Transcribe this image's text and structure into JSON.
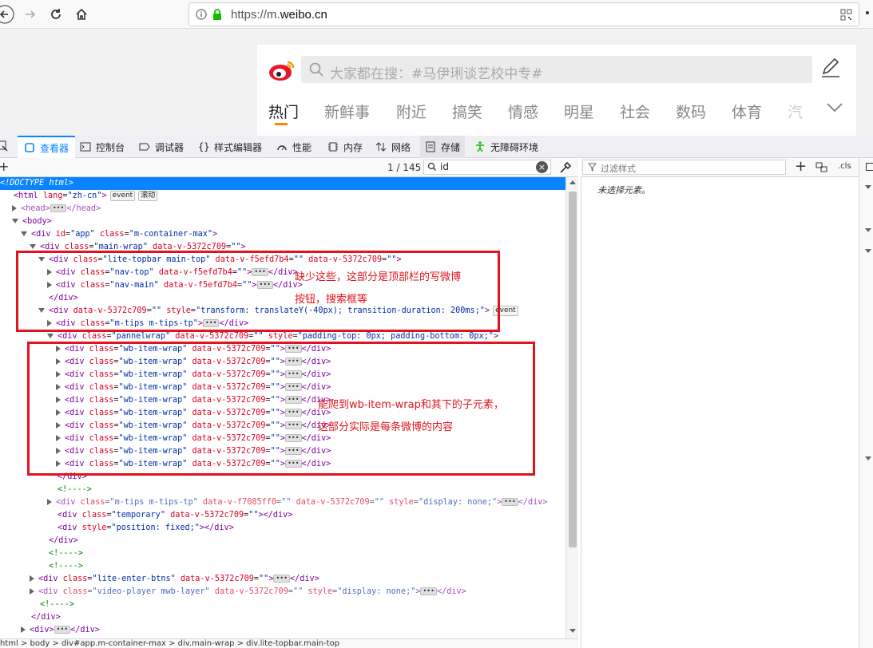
{
  "browser": {
    "url_prefix": "https://m.",
    "url_domain": "weibo.cn"
  },
  "weibo": {
    "search_placeholder": "大家都在搜：#马伊琍谈艺校中专#",
    "channels": [
      "热门",
      "新鲜事",
      "附近",
      "搞笑",
      "情感",
      "明星",
      "社会",
      "数码",
      "体育",
      "汽"
    ]
  },
  "devtools": {
    "tabs": [
      "查看器",
      "控制台",
      "调试器",
      "样式编辑器",
      "性能",
      "内存",
      "网络",
      "存储",
      "无障碍环境"
    ],
    "search_count": "1 / 145",
    "search_value": "id",
    "filter_placeholder": "过滤样式",
    "cls_label": ".cls",
    "no_selection": "未选择元素。",
    "event_badge": "event",
    "scroll_badge": "滚动",
    "breadcrumb": "html > body > div#app.m-container-max > div.main-wrap > div.lite-topbar.main-top"
  },
  "markup_lines": [
    {
      "i": 0,
      "t": "none",
      "sel": true,
      "h": [
        [
          "tx",
          "<!DOCTYPE html>"
        ]
      ]
    },
    {
      "i": 0,
      "t": "none",
      "h": [
        [
          "tg",
          "<html "
        ],
        [
          "at",
          "lang"
        ],
        [
          "tx",
          "="
        ],
        [
          "av",
          "\"zh-cn\""
        ],
        [
          "tg",
          ">"
        ]
      ],
      "b": [
        "event",
        "滚动"
      ]
    },
    {
      "i": 1,
      "t": "closed",
      "dim": true,
      "h": [
        [
          "tg",
          "<head>"
        ]
      ],
      "ell": true,
      "h2": [
        [
          "tg",
          "</head>"
        ]
      ]
    },
    {
      "i": 1,
      "t": "open",
      "h": [
        [
          "tg",
          "<body>"
        ]
      ]
    },
    {
      "i": 2,
      "t": "open",
      "h": [
        [
          "tg",
          "<div "
        ],
        [
          "at",
          "id"
        ],
        [
          "tx",
          "="
        ],
        [
          "av",
          "\"app\""
        ],
        [
          "at",
          " class"
        ],
        [
          "tx",
          "="
        ],
        [
          "av",
          "\"m-container-max\""
        ],
        [
          "tg",
          ">"
        ]
      ]
    },
    {
      "i": 3,
      "t": "open",
      "h": [
        [
          "tg",
          "<div "
        ],
        [
          "at",
          "class"
        ],
        [
          "tx",
          "="
        ],
        [
          "av",
          "\"main-wrap\""
        ],
        [
          "at",
          " data-v-5372c709"
        ],
        [
          "tx",
          "="
        ],
        [
          "av",
          "\"\""
        ],
        [
          "tg",
          ">"
        ]
      ]
    },
    {
      "i": 4,
      "t": "open",
      "h": [
        [
          "tg",
          "<div "
        ],
        [
          "at",
          "class"
        ],
        [
          "tx",
          "="
        ],
        [
          "av",
          "\"lite-topbar main-top\""
        ],
        [
          "at",
          " data-v-f5efd7b4"
        ],
        [
          "tx",
          "="
        ],
        [
          "av",
          "\"\""
        ],
        [
          "at",
          " data-v-5372c709"
        ],
        [
          "tx",
          "="
        ],
        [
          "av",
          "\"\""
        ],
        [
          "tg",
          ">"
        ]
      ]
    },
    {
      "i": 5,
      "t": "closed",
      "h": [
        [
          "tg",
          "<div "
        ],
        [
          "at",
          "class"
        ],
        [
          "tx",
          "="
        ],
        [
          "av",
          "\"nav-top\""
        ],
        [
          "at",
          " data-v-f5efd7b4"
        ],
        [
          "tx",
          "="
        ],
        [
          "av",
          "\"\""
        ],
        [
          "tg",
          ">"
        ]
      ],
      "ell": true,
      "h2": [
        [
          "tg",
          "</div>"
        ]
      ]
    },
    {
      "i": 5,
      "t": "closed",
      "h": [
        [
          "tg",
          "<div "
        ],
        [
          "at",
          "class"
        ],
        [
          "tx",
          "="
        ],
        [
          "av",
          "\"nav-main\""
        ],
        [
          "at",
          " data-v-f5efd7b4"
        ],
        [
          "tx",
          "="
        ],
        [
          "av",
          "\"\""
        ],
        [
          "tg",
          ">"
        ]
      ],
      "ell": true,
      "h2": [
        [
          "tg",
          "</div>"
        ]
      ]
    },
    {
      "i": 4,
      "t": "none",
      "h": [
        [
          "tg",
          "</div>"
        ]
      ]
    },
    {
      "i": 4,
      "t": "open",
      "h": [
        [
          "tg",
          "<div "
        ],
        [
          "at",
          "data-v-5372c709"
        ],
        [
          "tx",
          "="
        ],
        [
          "av",
          "\"\""
        ],
        [
          "at",
          " style"
        ],
        [
          "tx",
          "="
        ],
        [
          "av",
          "\"transform: translateY(-40px); transition-duration: 200ms;\""
        ],
        [
          "tg",
          ">"
        ]
      ],
      "b": [
        "event"
      ]
    },
    {
      "i": 5,
      "t": "closed",
      "h": [
        [
          "tg",
          "<div "
        ],
        [
          "at",
          "class"
        ],
        [
          "tx",
          "="
        ],
        [
          "av",
          "\"m-tips m-tips-tp\""
        ],
        [
          "tg",
          ">"
        ]
      ],
      "ell": true,
      "h2": [
        [
          "tg",
          "</div>"
        ]
      ]
    },
    {
      "i": 5,
      "t": "open",
      "h": [
        [
          "tg",
          "<div "
        ],
        [
          "at",
          "class"
        ],
        [
          "tx",
          "="
        ],
        [
          "av",
          "\"pannelwrap\""
        ],
        [
          "at",
          " data-v-5372c709"
        ],
        [
          "tx",
          "="
        ],
        [
          "av",
          "\"\""
        ],
        [
          "at",
          " style"
        ],
        [
          "tx",
          "="
        ],
        [
          "av",
          "\"padding-top: 0px; padding-bottom: 0px;\""
        ],
        [
          "tg",
          ">"
        ]
      ]
    },
    {
      "i": 6,
      "t": "closed",
      "h": [
        [
          "tg",
          "<div "
        ],
        [
          "at",
          "class"
        ],
        [
          "tx",
          "="
        ],
        [
          "av",
          "\"wb-item-wrap\""
        ],
        [
          "at",
          " data-v-5372c709"
        ],
        [
          "tx",
          "="
        ],
        [
          "av",
          "\"\""
        ],
        [
          "tg",
          ">"
        ]
      ],
      "ell": true,
      "h2": [
        [
          "tg",
          "</div>"
        ]
      ]
    },
    {
      "i": 6,
      "t": "closed",
      "h": [
        [
          "tg",
          "<div "
        ],
        [
          "at",
          "class"
        ],
        [
          "tx",
          "="
        ],
        [
          "av",
          "\"wb-item-wrap\""
        ],
        [
          "at",
          " data-v-5372c709"
        ],
        [
          "tx",
          "="
        ],
        [
          "av",
          "\"\""
        ],
        [
          "tg",
          ">"
        ]
      ],
      "ell": true,
      "h2": [
        [
          "tg",
          "</div>"
        ]
      ]
    },
    {
      "i": 6,
      "t": "closed",
      "h": [
        [
          "tg",
          "<div "
        ],
        [
          "at",
          "class"
        ],
        [
          "tx",
          "="
        ],
        [
          "av",
          "\"wb-item-wrap\""
        ],
        [
          "at",
          " data-v-5372c709"
        ],
        [
          "tx",
          "="
        ],
        [
          "av",
          "\"\""
        ],
        [
          "tg",
          ">"
        ]
      ],
      "ell": true,
      "h2": [
        [
          "tg",
          "</div>"
        ]
      ]
    },
    {
      "i": 6,
      "t": "closed",
      "h": [
        [
          "tg",
          "<div "
        ],
        [
          "at",
          "class"
        ],
        [
          "tx",
          "="
        ],
        [
          "av",
          "\"wb-item-wrap\""
        ],
        [
          "at",
          " data-v-5372c709"
        ],
        [
          "tx",
          "="
        ],
        [
          "av",
          "\"\""
        ],
        [
          "tg",
          ">"
        ]
      ],
      "ell": true,
      "h2": [
        [
          "tg",
          "</div>"
        ]
      ]
    },
    {
      "i": 6,
      "t": "closed",
      "h": [
        [
          "tg",
          "<div "
        ],
        [
          "at",
          "class"
        ],
        [
          "tx",
          "="
        ],
        [
          "av",
          "\"wb-item-wrap\""
        ],
        [
          "at",
          " data-v-5372c709"
        ],
        [
          "tx",
          "="
        ],
        [
          "av",
          "\"\""
        ],
        [
          "tg",
          ">"
        ]
      ],
      "ell": true,
      "h2": [
        [
          "tg",
          "</div>"
        ]
      ]
    },
    {
      "i": 6,
      "t": "closed",
      "h": [
        [
          "tg",
          "<div "
        ],
        [
          "at",
          "class"
        ],
        [
          "tx",
          "="
        ],
        [
          "av",
          "\"wb-item-wrap\""
        ],
        [
          "at",
          " data-v-5372c709"
        ],
        [
          "tx",
          "="
        ],
        [
          "av",
          "\"\""
        ],
        [
          "tg",
          ">"
        ]
      ],
      "ell": true,
      "h2": [
        [
          "tg",
          "</div>"
        ]
      ]
    },
    {
      "i": 6,
      "t": "closed",
      "h": [
        [
          "tg",
          "<div "
        ],
        [
          "at",
          "class"
        ],
        [
          "tx",
          "="
        ],
        [
          "av",
          "\"wb-item-wrap\""
        ],
        [
          "at",
          " data-v-5372c709"
        ],
        [
          "tx",
          "="
        ],
        [
          "av",
          "\"\""
        ],
        [
          "tg",
          ">"
        ]
      ],
      "ell": true,
      "h2": [
        [
          "tg",
          "</div>"
        ]
      ]
    },
    {
      "i": 6,
      "t": "closed",
      "h": [
        [
          "tg",
          "<div "
        ],
        [
          "at",
          "class"
        ],
        [
          "tx",
          "="
        ],
        [
          "av",
          "\"wb-item-wrap\""
        ],
        [
          "at",
          " data-v-5372c709"
        ],
        [
          "tx",
          "="
        ],
        [
          "av",
          "\"\""
        ],
        [
          "tg",
          ">"
        ]
      ],
      "ell": true,
      "h2": [
        [
          "tg",
          "</div>"
        ]
      ]
    },
    {
      "i": 6,
      "t": "closed",
      "h": [
        [
          "tg",
          "<div "
        ],
        [
          "at",
          "class"
        ],
        [
          "tx",
          "="
        ],
        [
          "av",
          "\"wb-item-wrap\""
        ],
        [
          "at",
          " data-v-5372c709"
        ],
        [
          "tx",
          "="
        ],
        [
          "av",
          "\"\""
        ],
        [
          "tg",
          ">"
        ]
      ],
      "ell": true,
      "h2": [
        [
          "tg",
          "</div>"
        ]
      ]
    },
    {
      "i": 6,
      "t": "closed",
      "h": [
        [
          "tg",
          "<div "
        ],
        [
          "at",
          "class"
        ],
        [
          "tx",
          "="
        ],
        [
          "av",
          "\"wb-item-wrap\""
        ],
        [
          "at",
          " data-v-5372c709"
        ],
        [
          "tx",
          "="
        ],
        [
          "av",
          "\"\""
        ],
        [
          "tg",
          ">"
        ]
      ],
      "ell": true,
      "h2": [
        [
          "tg",
          "</div>"
        ]
      ]
    },
    {
      "i": 5,
      "t": "none",
      "h": [
        [
          "tg",
          "</div>"
        ]
      ]
    },
    {
      "i": 5,
      "t": "none",
      "h": [
        [
          "cm",
          "<!---->"
        ]
      ]
    },
    {
      "i": 5,
      "t": "closed",
      "dim": true,
      "h": [
        [
          "tg",
          "<div "
        ],
        [
          "at",
          "class"
        ],
        [
          "tx",
          "="
        ],
        [
          "av",
          "\"m-tips m-tips-tp\""
        ],
        [
          "at",
          " data-v-f7085ff0"
        ],
        [
          "tx",
          "="
        ],
        [
          "av",
          "\"\""
        ],
        [
          "at",
          " data-v-5372c709"
        ],
        [
          "tx",
          "="
        ],
        [
          "av",
          "\"\""
        ],
        [
          "at",
          " style"
        ],
        [
          "tx",
          "="
        ],
        [
          "av",
          "\"display: none;\""
        ],
        [
          "tg",
          ">"
        ]
      ],
      "ell": true,
      "h2": [
        [
          "tg",
          "</div>"
        ]
      ]
    },
    {
      "i": 5,
      "t": "none",
      "h": [
        [
          "tg",
          "<div "
        ],
        [
          "at",
          "class"
        ],
        [
          "tx",
          "="
        ],
        [
          "av",
          "\"temporary\""
        ],
        [
          "at",
          " data-v-5372c709"
        ],
        [
          "tx",
          "="
        ],
        [
          "av",
          "\"\""
        ],
        [
          "tg",
          "></div>"
        ]
      ]
    },
    {
      "i": 5,
      "t": "none",
      "h": [
        [
          "tg",
          "<div "
        ],
        [
          "at",
          "style"
        ],
        [
          "tx",
          "="
        ],
        [
          "av",
          "\"position: fixed;\""
        ],
        [
          "tg",
          "></div>"
        ]
      ]
    },
    {
      "i": 4,
      "t": "none",
      "h": [
        [
          "tg",
          "</div>"
        ]
      ]
    },
    {
      "i": 4,
      "t": "none",
      "h": [
        [
          "cm",
          "<!---->"
        ]
      ]
    },
    {
      "i": 4,
      "t": "none",
      "h": [
        [
          "cm",
          "<!---->"
        ]
      ]
    },
    {
      "i": 3,
      "t": "closed",
      "h": [
        [
          "tg",
          "<div "
        ],
        [
          "at",
          "class"
        ],
        [
          "tx",
          "="
        ],
        [
          "av",
          "\"lite-enter-btns\""
        ],
        [
          "at",
          " data-v-5372c709"
        ],
        [
          "tx",
          "="
        ],
        [
          "av",
          "\"\""
        ],
        [
          "tg",
          ">"
        ]
      ],
      "ell": true,
      "h2": [
        [
          "tg",
          "</div>"
        ]
      ]
    },
    {
      "i": 3,
      "t": "closed",
      "dim": true,
      "h": [
        [
          "tg",
          "<div "
        ],
        [
          "at",
          "class"
        ],
        [
          "tx",
          "="
        ],
        [
          "av",
          "\"video-player mwb-layer\""
        ],
        [
          "at",
          " data-v-5372c709"
        ],
        [
          "tx",
          "="
        ],
        [
          "av",
          "\"\""
        ],
        [
          "at",
          " style"
        ],
        [
          "tx",
          "="
        ],
        [
          "av",
          "\"display: none;\""
        ],
        [
          "tg",
          ">"
        ]
      ],
      "ell": true,
      "h2": [
        [
          "tg",
          "</div>"
        ]
      ]
    },
    {
      "i": 3,
      "t": "none",
      "h": [
        [
          "cm",
          "<!---->"
        ]
      ]
    },
    {
      "i": 2,
      "t": "none",
      "h": [
        [
          "tg",
          "</div>"
        ]
      ]
    },
    {
      "i": 2,
      "t": "closed",
      "h": [
        [
          "tg",
          "<div>"
        ]
      ],
      "ell": true,
      "h2": [
        [
          "tg",
          "</div>"
        ]
      ]
    }
  ],
  "annotations": {
    "note1_line1": "缺少这些，这部分是顶部栏的写微博",
    "note1_line2": "按钮，搜索框等",
    "note2_line1": "能爬到wb-item-wrap和其下的子元素，",
    "note2_line2": "这部分实际是每条微博的内容",
    "color": "#e0141e"
  }
}
